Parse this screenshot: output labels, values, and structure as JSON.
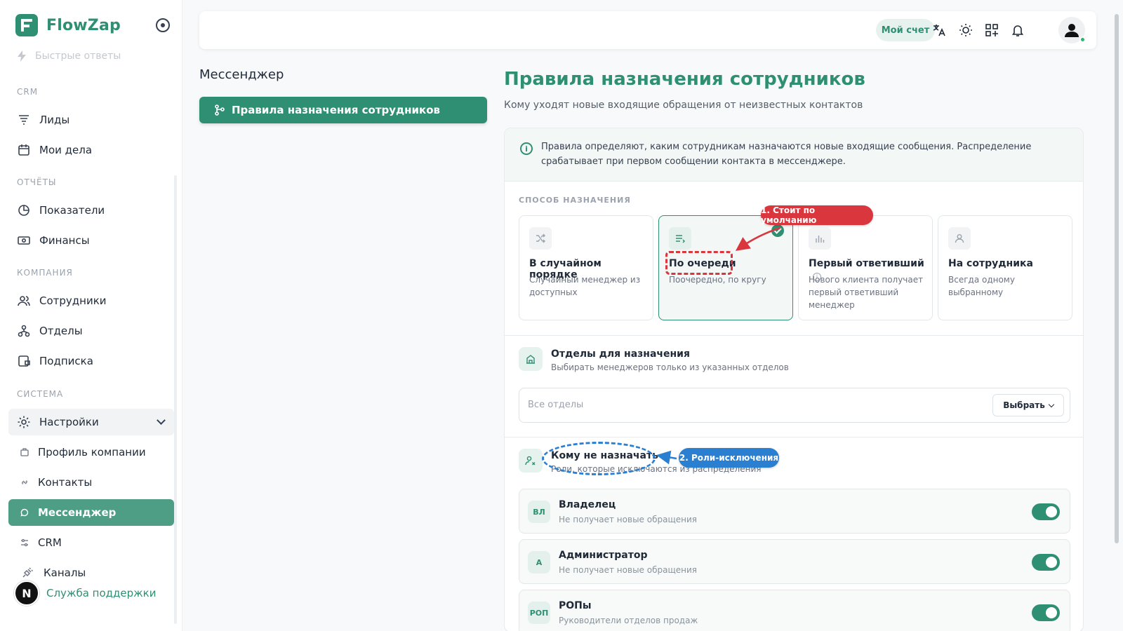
{
  "app": {
    "name": "FlowZap"
  },
  "sidebar": {
    "faded_item": "Быстрые ответы",
    "sections": {
      "crm": "CRM",
      "reports": "ОТЧЁТЫ",
      "company": "КОМПАНИЯ",
      "system": "СИСТЕМА"
    },
    "items": {
      "leads": "Лиды",
      "my_tasks": "Мои дела",
      "metrics": "Показатели",
      "finance": "Финансы",
      "employees": "Сотрудники",
      "departments": "Отделы",
      "subscription": "Подписка",
      "settings": "Настройки",
      "company_profile": "Профиль компании",
      "contacts": "Контакты",
      "messenger": "Мессенджер",
      "crm": "CRM",
      "channels": "Каналы"
    },
    "support": {
      "avatar": "N",
      "label": "Служба поддержки"
    }
  },
  "topbar": {
    "account_label": "Мой счет"
  },
  "left_panel": {
    "title": "Мессенджер",
    "active_item": "Правила назначения сотрудников"
  },
  "main": {
    "title": "Правила назначения сотрудников",
    "subtitle": "Кому уходят новые входящие обращения от неизвестных контактов",
    "info_text": "Правила определяют, каким сотрудникам назначаются новые входящие сообщения. Распределение срабатывает при первом сообщении контакта в мессенджере.",
    "method_label": "СПОСОБ НАЗНАЧЕНИЯ",
    "options": [
      {
        "title": "В случайном порядке",
        "desc": "Случайный менеджер из доступных"
      },
      {
        "title": "По очереди",
        "desc": "Поочередно, по кругу"
      },
      {
        "title": "Первый ответивший",
        "desc": "Нового клиента получает первый ответивший менеджер"
      },
      {
        "title": "На сотрудника",
        "desc": "Всегда одному выбранному"
      }
    ],
    "departments": {
      "title": "Отделы для назначения",
      "subtitle": "Выбирать менеджеров только из указанных отделов",
      "placeholder": "Все отделы",
      "select_label": "Выбрать"
    },
    "exclusions": {
      "title": "Кому не назначать",
      "subtitle": "Роли, которые исключаются из распределения",
      "roles": [
        {
          "badge": "ВЛ",
          "name": "Владелец",
          "desc": "Не получает новые обращения",
          "enabled": true
        },
        {
          "badge": "А",
          "name": "Администратор",
          "desc": "Не получает новые обращения",
          "enabled": true
        },
        {
          "badge": "РОП",
          "name": "РОПы",
          "desc": "Руководители отделов продаж",
          "enabled": true
        }
      ]
    }
  },
  "annotations": {
    "red": "1. Стоит по умолчанию",
    "blue": "2. Роли-исключения"
  },
  "colors": {
    "accent": "#2f8f73",
    "annotation_red": "#d9363e",
    "annotation_blue": "#2b7fd1"
  }
}
